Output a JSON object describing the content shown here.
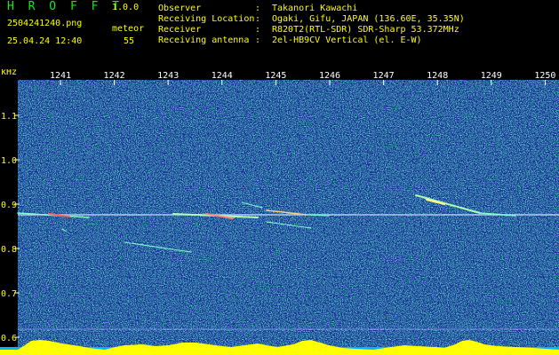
{
  "header": {
    "app_title": "H R O F F T",
    "version": "1.0.0",
    "filename": "2504241240.png",
    "detector_label": "meteor",
    "datetime": "25.04.24 12:40",
    "meteor_count": "55",
    "fields": [
      {
        "label": "Observer",
        "value": "Takanori Kawachi"
      },
      {
        "label": "Receiving Location",
        "value": "Ogaki, Gifu, JAPAN (136.60E, 35.35N)"
      },
      {
        "label": "Receiver",
        "value": "R820T2(RTL-SDR) SDR-Sharp 53.372MHz"
      },
      {
        "label": "Receiving antenna",
        "value": "2el-HB9CV Vertical (el. E-W)"
      }
    ],
    "separator": ":"
  },
  "spectrogram": {
    "y_unit": "kHz",
    "y_ticks": [
      "1.1",
      "1.0",
      "0.9",
      "0.8",
      "0.7",
      "0.6"
    ],
    "time_ticks": [
      "1241",
      "1242",
      "1243",
      "1244",
      "1245",
      "1246",
      "1247",
      "1248",
      "1249",
      "1250"
    ],
    "colors": {
      "background": "#1a2a9a",
      "carrier": "#c8dcff",
      "level_bar": "#ffff00",
      "base": "#00b4ff"
    }
  }
}
